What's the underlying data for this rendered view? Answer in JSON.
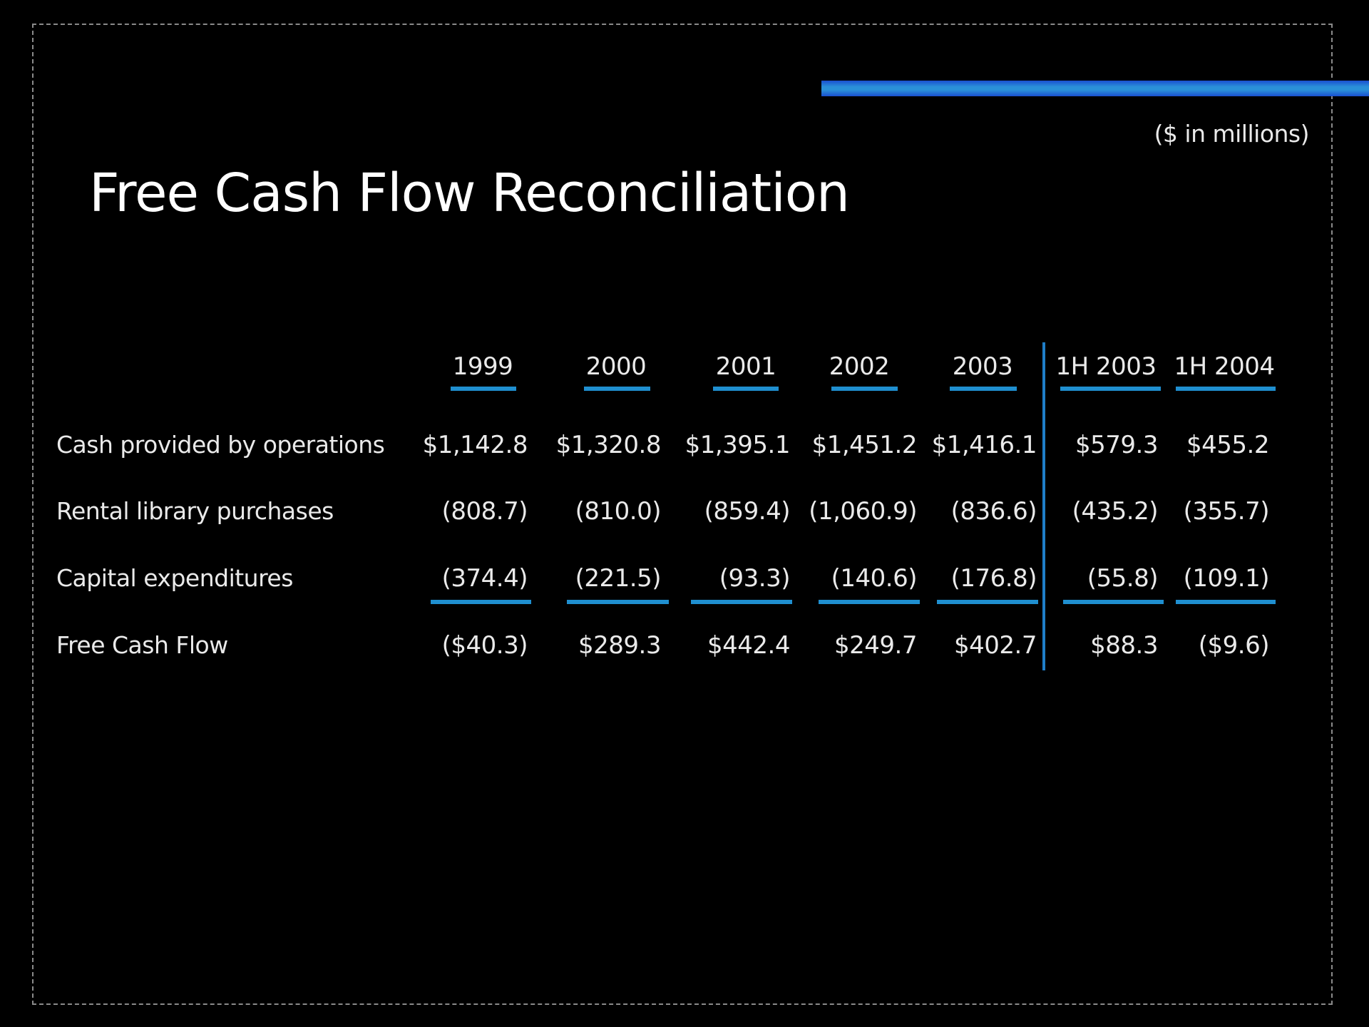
{
  "slide": {
    "title": "Free Cash Flow Reconciliation",
    "units_note": "($ in millions)",
    "accent_color": "#2a90d8"
  },
  "table": {
    "columns": [
      "1999",
      "2000",
      "2001",
      "2002",
      "2003",
      "1H 2003",
      "1H 2004"
    ],
    "rows": [
      {
        "label": "Cash provided by operations",
        "values": [
          "$1,142.8",
          "$1,320.8",
          "$1,395.1",
          "$1,451.2",
          "$1,416.1",
          "$579.3",
          "$455.2"
        ]
      },
      {
        "label": "Rental library purchases",
        "values": [
          "(808.7)",
          "(810.0)",
          "(859.4)",
          "(1,060.9)",
          "(836.6)",
          "(435.2)",
          "(355.7)"
        ]
      },
      {
        "label": "Capital expenditures",
        "values": [
          "(374.4)",
          "(221.5)",
          "(93.3)",
          "(140.6)",
          "(176.8)",
          "(55.8)",
          "(109.1)"
        ]
      },
      {
        "label": "Free Cash Flow",
        "values": [
          "($40.3)",
          "$289.3",
          "$442.4",
          "$249.7",
          "$402.7",
          "$88.3",
          "($9.6)"
        ]
      }
    ]
  }
}
